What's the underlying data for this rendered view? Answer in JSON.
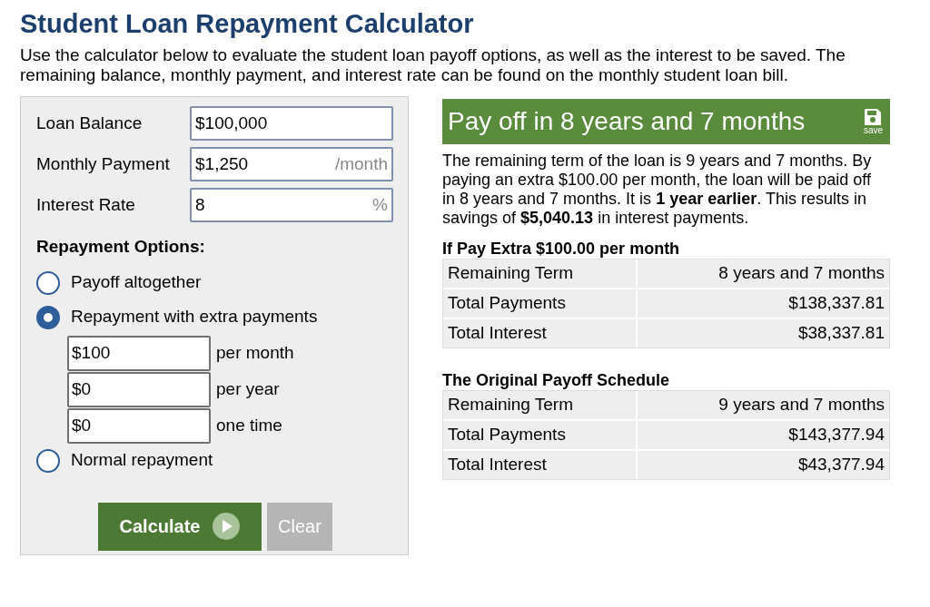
{
  "title": "Student Loan Repayment Calculator",
  "intro": "Use the calculator below to evaluate the student loan payoff options, as well as the interest to be saved. The remaining balance, monthly payment, and interest rate can be found on the monthly student loan bill.",
  "fields": [
    {
      "label": "Loan Balance",
      "value": "$100,000"
    },
    {
      "label": "Monthly Payment",
      "value": "$1,250",
      "unit": "/month"
    },
    {
      "label": "Interest Rate",
      "value": "8",
      "unit": "%"
    }
  ],
  "repayment": {
    "title": "Repayment Options:",
    "options": [
      {
        "label": "Payoff altogether",
        "selected": false
      },
      {
        "label": "Repayment with extra payments",
        "selected": true,
        "extras": [
          {
            "value": "$100",
            "label": "per month"
          },
          {
            "value": "$0",
            "label": "per year"
          },
          {
            "value": "$0",
            "label": "one time"
          }
        ]
      },
      {
        "label": "Normal repayment",
        "selected": false
      }
    ]
  },
  "buttons": {
    "calculate": "Calculate",
    "clear": "Clear"
  },
  "result": {
    "heading": "Pay off in 8 years and 7 months",
    "save": "save",
    "summary": "The remaining term of the loan is 9 years and 7 months. By paying an extra $100.00 per month, the loan will be paid off in 8 years and 7 months. It is **1 year earlier**. This results in savings of **$5,040.13** in interest payments.",
    "tables": [
      {
        "title": "If Pay Extra $100.00 per month",
        "rows": [
          {
            "label": "Remaining Term",
            "value": "8 years and 7 months"
          },
          {
            "label": "Total Payments",
            "value": "$138,337.81"
          },
          {
            "label": "Total Interest",
            "value": "$38,337.81"
          }
        ]
      },
      {
        "title": "The Original Payoff Schedule",
        "rows": [
          {
            "label": "Remaining Term",
            "value": "9 years and 7 months"
          },
          {
            "label": "Total Payments",
            "value": "$143,377.94"
          },
          {
            "label": "Total Interest",
            "value": "$43,377.94"
          }
        ]
      }
    ]
  }
}
